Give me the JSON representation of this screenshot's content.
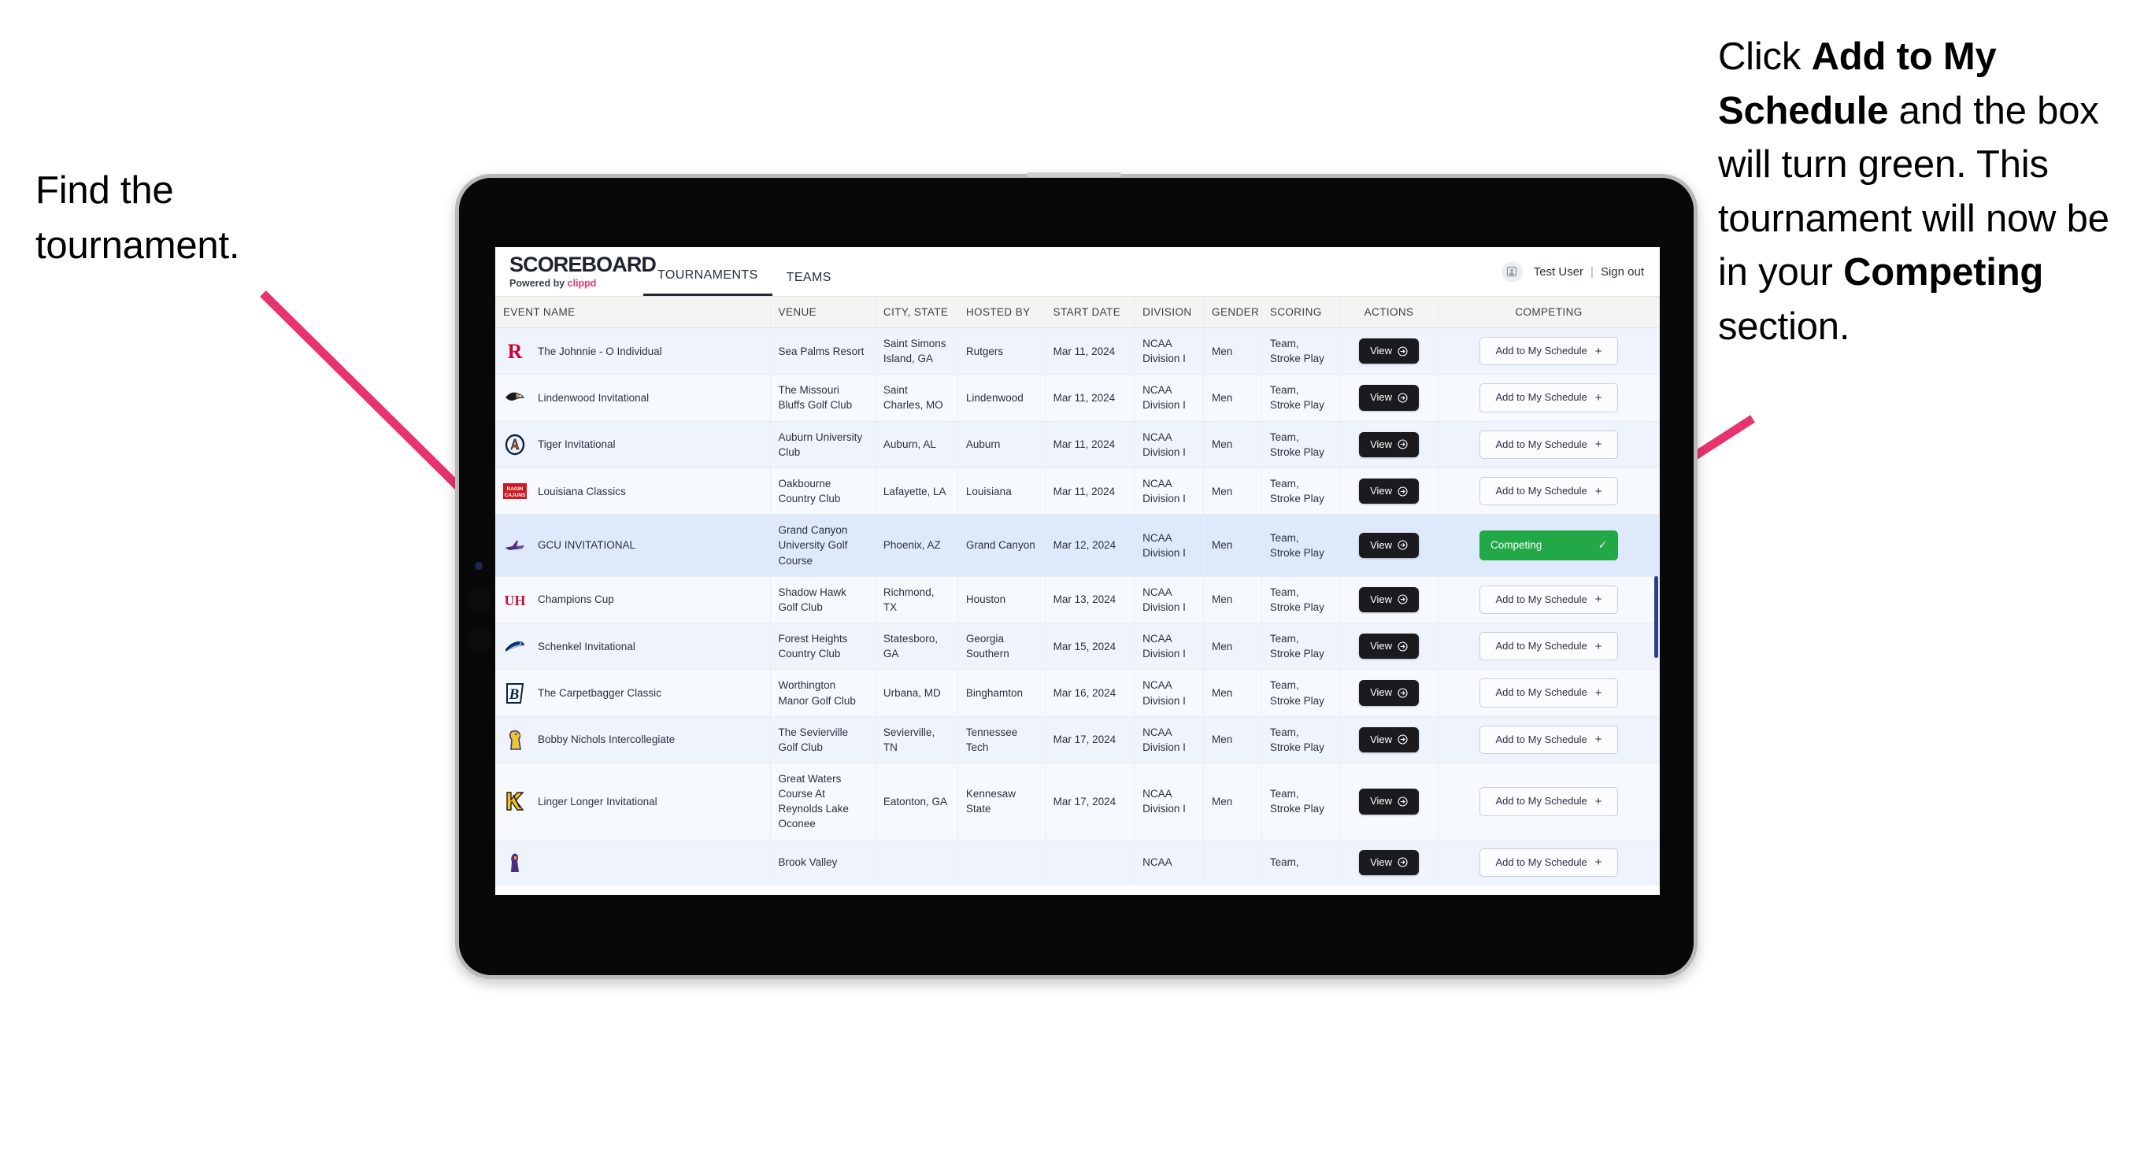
{
  "annotations": {
    "left": "Find the tournament.",
    "right_parts": [
      {
        "t": "Click ",
        "b": false
      },
      {
        "t": "Add to My Schedule",
        "b": true
      },
      {
        "t": " and the box will turn green. This tournament will now be in your ",
        "b": false
      },
      {
        "t": "Competing",
        "b": true
      },
      {
        "t": " section.",
        "b": false
      }
    ],
    "arrow_color": "#e8336d"
  },
  "app": {
    "brand": {
      "title": "SCOREBOARD",
      "powered_prefix": "Powered by ",
      "powered_brand": "clippd"
    },
    "nav": [
      {
        "label": "TOURNAMENTS",
        "active": true
      },
      {
        "label": "TEAMS",
        "active": false
      }
    ],
    "user": {
      "name": "Test User",
      "separator": "|",
      "signout": "Sign out",
      "avatar_icon": "user-badge-icon"
    },
    "table": {
      "columns": [
        "EVENT NAME",
        "VENUE",
        "CITY, STATE",
        "HOSTED BY",
        "START DATE",
        "DIVISION",
        "GENDER",
        "SCORING",
        "ACTIONS",
        "COMPETING"
      ],
      "view_label": "View",
      "add_label": "Add to My Schedule",
      "add_plus": "+",
      "competing_label": "Competing",
      "competing_check": "✓",
      "competing_color": "#22a846",
      "rows": [
        {
          "logo": "rutgers",
          "event": "The Johnnie - O Individual",
          "venue": "Sea Palms Resort",
          "city": "Saint Simons Island, GA",
          "host": "Rutgers",
          "date": "Mar 11, 2024",
          "division": "NCAA Division I",
          "gender": "Men",
          "scoring": "Team, Stroke Play",
          "competing": false
        },
        {
          "logo": "lindenwood",
          "event": "Lindenwood Invitational",
          "venue": "The Missouri Bluffs Golf Club",
          "city": "Saint Charles, MO",
          "host": "Lindenwood",
          "date": "Mar 11, 2024",
          "division": "NCAA Division I",
          "gender": "Men",
          "scoring": "Team, Stroke Play",
          "competing": false
        },
        {
          "logo": "auburn",
          "event": "Tiger Invitational",
          "venue": "Auburn University Club",
          "city": "Auburn, AL",
          "host": "Auburn",
          "date": "Mar 11, 2024",
          "division": "NCAA Division I",
          "gender": "Men",
          "scoring": "Team, Stroke Play",
          "competing": false
        },
        {
          "logo": "louisiana",
          "event": "Louisiana Classics",
          "venue": "Oakbourne Country Club",
          "city": "Lafayette, LA",
          "host": "Louisiana",
          "date": "Mar 11, 2024",
          "division": "NCAA Division I",
          "gender": "Men",
          "scoring": "Team, Stroke Play",
          "competing": false
        },
        {
          "logo": "gcu",
          "event": "GCU INVITATIONAL",
          "venue": "Grand Canyon University Golf Course",
          "city": "Phoenix, AZ",
          "host": "Grand Canyon",
          "date": "Mar 12, 2024",
          "division": "NCAA Division I",
          "gender": "Men",
          "scoring": "Team, Stroke Play",
          "competing": true
        },
        {
          "logo": "houston",
          "event": "Champions Cup",
          "venue": "Shadow Hawk Golf Club",
          "city": "Richmond, TX",
          "host": "Houston",
          "date": "Mar 13, 2024",
          "division": "NCAA Division I",
          "gender": "Men",
          "scoring": "Team, Stroke Play",
          "competing": false
        },
        {
          "logo": "georgiasouthern",
          "event": "Schenkel Invitational",
          "venue": "Forest Heights Country Club",
          "city": "Statesboro, GA",
          "host": "Georgia Southern",
          "date": "Mar 15, 2024",
          "division": "NCAA Division I",
          "gender": "Men",
          "scoring": "Team, Stroke Play",
          "competing": false
        },
        {
          "logo": "binghamton",
          "event": "The Carpetbagger Classic",
          "venue": "Worthington Manor Golf Club",
          "city": "Urbana, MD",
          "host": "Binghamton",
          "date": "Mar 16, 2024",
          "division": "NCAA Division I",
          "gender": "Men",
          "scoring": "Team, Stroke Play",
          "competing": false
        },
        {
          "logo": "tennesseetech",
          "event": "Bobby Nichols Intercollegiate",
          "venue": "The Sevierville Golf Club",
          "city": "Sevierville, TN",
          "host": "Tennessee Tech",
          "date": "Mar 17, 2024",
          "division": "NCAA Division I",
          "gender": "Men",
          "scoring": "Team, Stroke Play",
          "competing": false
        },
        {
          "logo": "kennesaw",
          "event": "Linger Longer Invitational",
          "venue": "Great Waters Course At Reynolds Lake Oconee",
          "city": "Eatonton, GA",
          "host": "Kennesaw State",
          "date": "Mar 17, 2024",
          "division": "NCAA Division I",
          "gender": "Men",
          "scoring": "Team, Stroke Play",
          "competing": false
        },
        {
          "logo": "ecu",
          "event": "",
          "venue": "Brook Valley",
          "city": "",
          "host": "",
          "date": "",
          "division": "NCAA",
          "gender": "",
          "scoring": "Team,",
          "competing": false
        }
      ]
    }
  }
}
